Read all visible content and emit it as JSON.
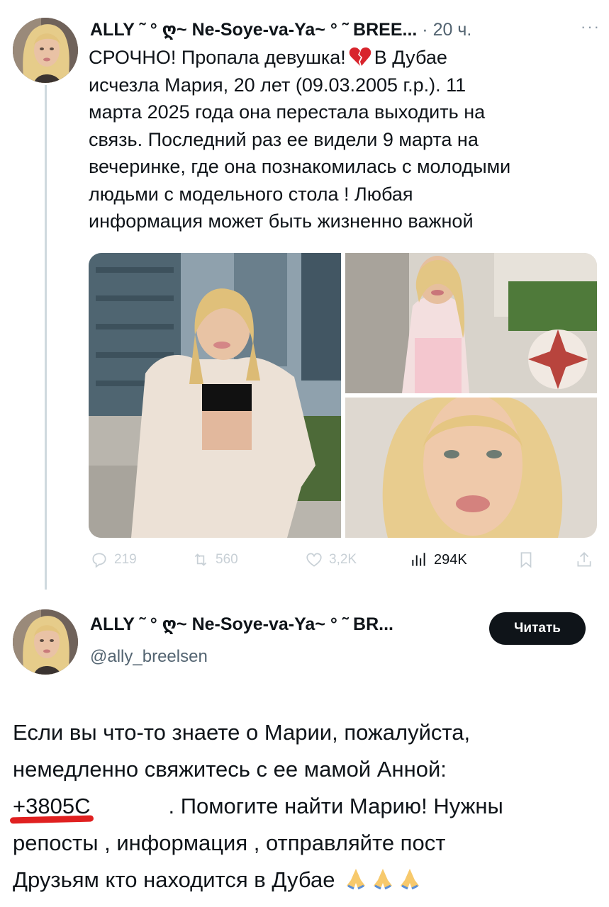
{
  "tweet1": {
    "author_name": "ALLY ˜ ° ღ~ Ne-Soye-va-Ya~ ° ˜ BREE...",
    "separator": "·",
    "time": "20 ч.",
    "more": "···",
    "text_part1": "СРОЧНО! Пропала девушка!",
    "text_part2": "В Дубае",
    "lines": [
      "исчезла Мария, 20 лет (09.03.2005 г.р.). 11",
      "марта 2025 года она перестала выходить на",
      "связь. Последний раз ее видели 9 марта на",
      "вечеринке, где она познакомилась с молодыми",
      "людьми с модельного стола ! Любая",
      "информация может быть жизненно важной"
    ],
    "stats": {
      "replies": "219",
      "reposts": "560",
      "likes": "3,2K",
      "views": "294K"
    }
  },
  "tweet2": {
    "author_name": "ALLY ˜ ° ღ~ Ne-Soye-va-Ya~ ° ˜ BR...",
    "handle": "@ally_breelsen",
    "follow_label": "Читать",
    "line1": "Если вы что-то знаете о Марии, пожалуйста,",
    "line2": "немедленно свяжитесь с ее мамой Анной:",
    "phone": "+3805C",
    "line3_rest": ". Помогите найти Марию! Нужны",
    "line4": "репосты , информация , отправляйте  пост",
    "line5": "Друзьям кто находится в Дубае"
  },
  "colors": {
    "accent_dark": "#0f1419",
    "muted": "#536471",
    "action_grey": "#c8d0d6",
    "thread_line": "#cfd9de",
    "phone_underline": "#e02020"
  },
  "icons": [
    "broken-heart-icon",
    "reply-icon",
    "repost-icon",
    "like-icon",
    "views-icon",
    "bookmark-icon",
    "share-icon",
    "praying-hands-icon"
  ]
}
